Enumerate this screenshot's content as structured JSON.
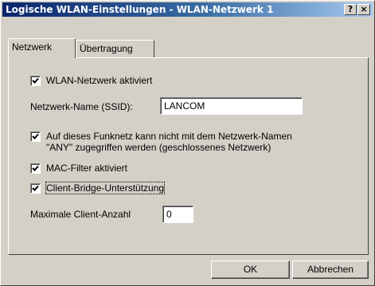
{
  "window": {
    "title": "Logische WLAN-Einstellungen - WLAN-Netzwerk 1"
  },
  "titlebar_buttons": {
    "help": "?",
    "close": "×"
  },
  "tabs": [
    {
      "label": "Netzwerk",
      "active": true
    },
    {
      "label": "Übertragung",
      "active": false
    }
  ],
  "network": {
    "wlan_enabled": {
      "label": "WLAN-Netzwerk aktiviert",
      "checked": true
    },
    "ssid": {
      "label": "Netzwerk-Name (SSID):",
      "value": "LANCOM"
    },
    "closed_network": {
      "label_line1": "Auf dieses Funknetz kann nicht mit dem  Netzwerk-Namen",
      "label_line2": "\"ANY\" zugegriffen werden (geschlossenes Netzwerk)",
      "checked": true
    },
    "mac_filter": {
      "label": "MAC-Filter aktiviert",
      "checked": true
    },
    "client_bridge": {
      "label": "Client-Bridge-Unterstützung",
      "checked": true
    },
    "max_clients": {
      "label": "Maximale Client-Anzahl",
      "value": "0"
    }
  },
  "buttons": {
    "ok": "OK",
    "cancel": "Abbrechen"
  }
}
